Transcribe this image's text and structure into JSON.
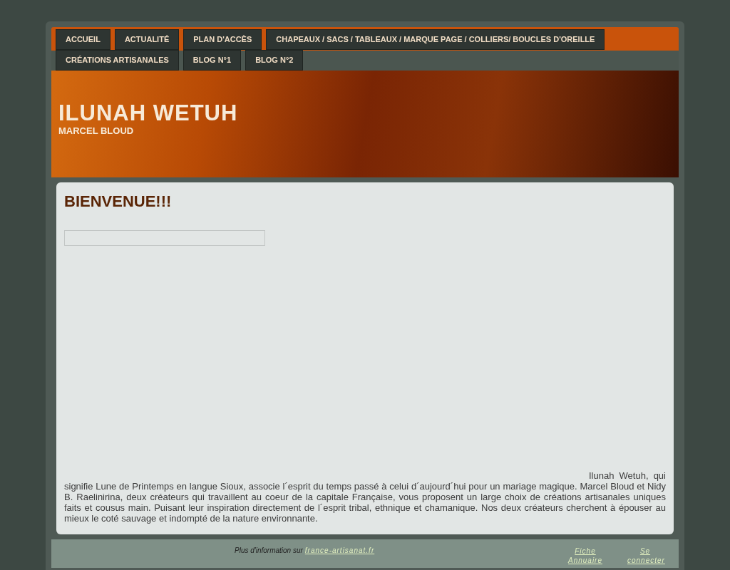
{
  "menu": [
    {
      "label": "ACCUEIL"
    },
    {
      "label": "ACTUALITÉ"
    },
    {
      "label": "PLAN D'ACCÈS"
    },
    {
      "label": "CHAPEAUX / SACS / TABLEAUX / MARQUE PAGE / COLLIERS/ BOUCLES D'OREILLE"
    },
    {
      "label": "CRÉATIONS ARTISANALES"
    },
    {
      "label": "BLOG N°1"
    },
    {
      "label": "BLOG N°2"
    }
  ],
  "header": {
    "title": "ILUNAH WETUH",
    "subtitle": "MARCEL BLOUD"
  },
  "content": {
    "heading": "BIENVENUE!!!",
    "paragraph": "Ilunah  Wetuh,  qui signifie Lune de Printemps en langue Sioux, associe l´esprit du temps passé à celui d´aujourd´hui pour un mariage magique. Marcel Bloud et Nidy B. Raelinirina, deux créateurs qui travaillent au coeur de la capitale Française, vous proposent un large choix de créations artisanales uniques faits et cousus main. Puisant leur inspiration directement de l´esprit tribal, ethnique et chamanique. Nos deux créateurs cherchent à épouser au mieux le coté sauvage et indompté de la nature environnante."
  },
  "footer": {
    "info": "Plus d'information sur",
    "link": "france-artisanat.fr",
    "links": [
      "Fiche Annuaire",
      "Se connecter"
    ]
  }
}
